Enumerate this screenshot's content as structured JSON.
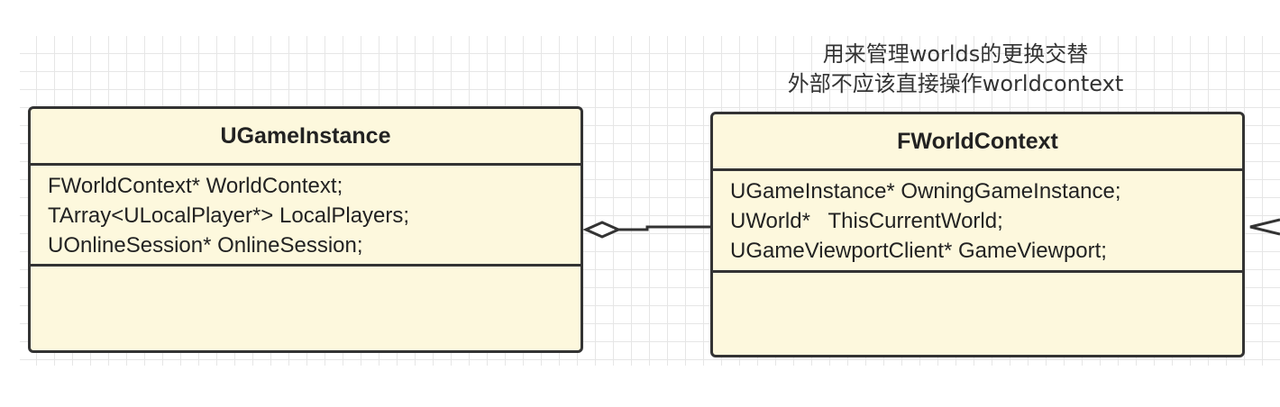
{
  "diagram": {
    "note": {
      "line1": "用来管理worlds的更换交替",
      "line2": "外部不应该直接操作worldcontext"
    },
    "classes": [
      {
        "name": "UGameInstance",
        "attributes": [
          "FWorldContext* WorldContext;",
          "TArray<ULocalPlayer*> LocalPlayers;",
          "UOnlineSession* OnlineSession;"
        ]
      },
      {
        "name": "FWorldContext",
        "attributes": [
          "UGameInstance* OwningGameInstance;",
          "UWorld*   ThisCurrentWorld;",
          "UGameViewportClient* GameViewport;"
        ]
      }
    ],
    "relations": [
      {
        "type": "aggregation",
        "from": "FWorldContext",
        "to": "UGameInstance"
      }
    ],
    "colors": {
      "class_fill": "#fdf8dd",
      "class_stroke": "#333333",
      "grid": "#e6e6e6"
    }
  }
}
